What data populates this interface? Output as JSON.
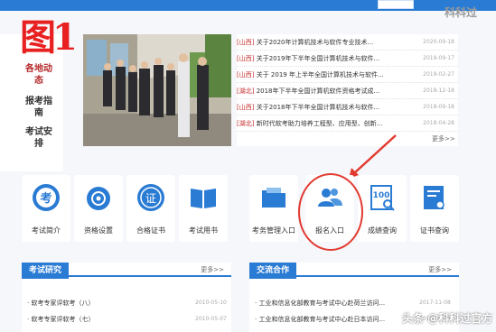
{
  "watermark_top": "科科过",
  "figure_label": "图1",
  "side_nav": [
    {
      "label": "各地动态",
      "active": true
    },
    {
      "label": "报考指南",
      "active": false
    },
    {
      "label": "考试安排",
      "active": false
    }
  ],
  "news": [
    {
      "region": "[山西]",
      "title": " 关于2020年计算机技术与软件专业技术...",
      "date": "2020-09-18"
    },
    {
      "region": "[山西]",
      "title": " 关于2019年下半年全国计算机技术与软件...",
      "date": "2019-09-17"
    },
    {
      "region": "[山西]",
      "title": " 关于 2019 年上半年全国计算机技术与软件...",
      "date": "2019-02-27"
    },
    {
      "region": "[湖北]",
      "title": " 2018年下半年全国计算机软件资格考试成...",
      "date": "2018-12-18"
    },
    {
      "region": "[山西]",
      "title": " 关于2018年下半年全国计算机技术与软件...",
      "date": "2018-09-18"
    },
    {
      "region": "[湖北]",
      "title": " 新时代软考助力培养工程型、应用型、创新...",
      "date": "2018-04-28"
    }
  ],
  "news_more": "更多>>",
  "tiles": [
    {
      "label": "考试简介",
      "icon": "kao-badge-icon"
    },
    {
      "label": "资格设置",
      "icon": "medal-icon"
    },
    {
      "label": "合格证书",
      "icon": "certificate-icon"
    },
    {
      "label": "考试用书",
      "icon": "book-icon"
    },
    {
      "label": "考务管理入口",
      "icon": "folder-icon"
    },
    {
      "label": "报名入口",
      "icon": "users-icon"
    },
    {
      "label": "成绩查询",
      "icon": "score-100-icon"
    },
    {
      "label": "证书查询",
      "icon": "certificate-search-icon"
    }
  ],
  "panel_research": {
    "title": "考试研究",
    "more": "更多>>",
    "items": [
      {
        "text": "·  软考专家评软考（八）",
        "date": "2010-05-10"
      },
      {
        "text": "·  软考专家评软考（七）",
        "date": "2010-05-07"
      }
    ]
  },
  "panel_coop": {
    "title": "交流合作",
    "more": "更多>>",
    "items": [
      {
        "text": "·  工业和信息化部教育与考试中心赴荷兰访问...",
        "date": "2017-11-08"
      },
      {
        "text": "·  工业和信息化部教育与考试中心赴日本访问...",
        "date": "2017-10-12"
      }
    ]
  },
  "watermark_bottom": "头条 @科科过官方",
  "colors": {
    "accent": "#2a7bd4",
    "news_region": "#c62d2d",
    "highlight": "#e23a30"
  }
}
